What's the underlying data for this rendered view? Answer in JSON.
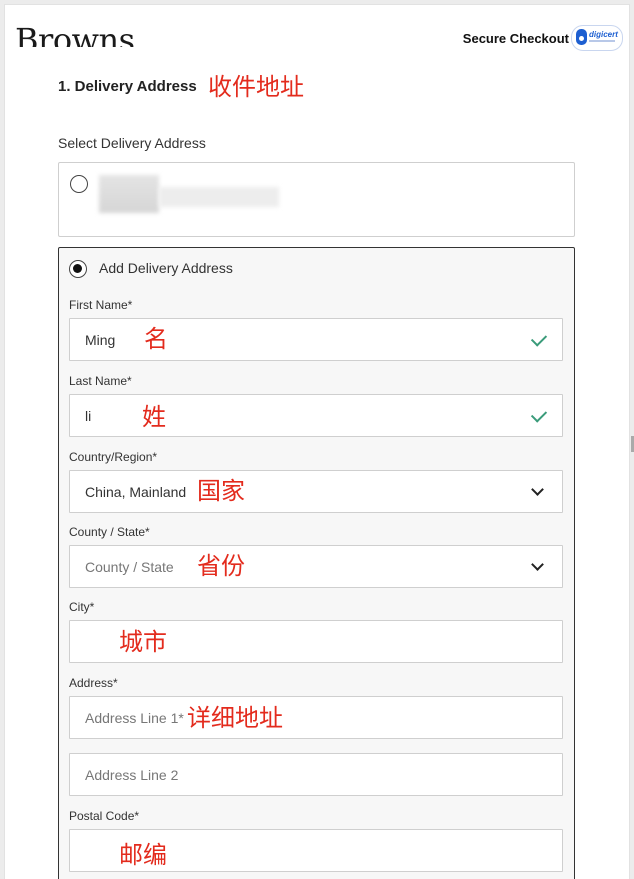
{
  "header": {
    "logo": "Browns",
    "secure_checkout": "Secure Checkout",
    "badge_text": "digicert"
  },
  "step": {
    "title": "1. Delivery Address",
    "title_cn": "收件地址"
  },
  "saved_addresses": {
    "label": "Select Delivery Address"
  },
  "new_address": {
    "label": "Add Delivery Address",
    "first_name": {
      "label": "First Name*",
      "value": "Ming",
      "cn": "名"
    },
    "last_name": {
      "label": "Last Name*",
      "value": "li",
      "cn": "姓"
    },
    "country": {
      "label": "Country/Region*",
      "value": "China, Mainland",
      "cn": "国家"
    },
    "state": {
      "label": "County / State*",
      "placeholder": "County / State",
      "cn": "省份"
    },
    "city": {
      "label": "City*",
      "value": "",
      "cn": "城市"
    },
    "address": {
      "label": "Address*",
      "line1_placeholder": "Address Line 1*",
      "line2_placeholder": "Address Line 2",
      "cn": "详细地址"
    },
    "postal": {
      "label": "Postal Code*",
      "value": "",
      "cn": "邮编"
    }
  },
  "colors": {
    "annotation_red": "#e32b1d",
    "valid_green": "#3a9b7a"
  }
}
